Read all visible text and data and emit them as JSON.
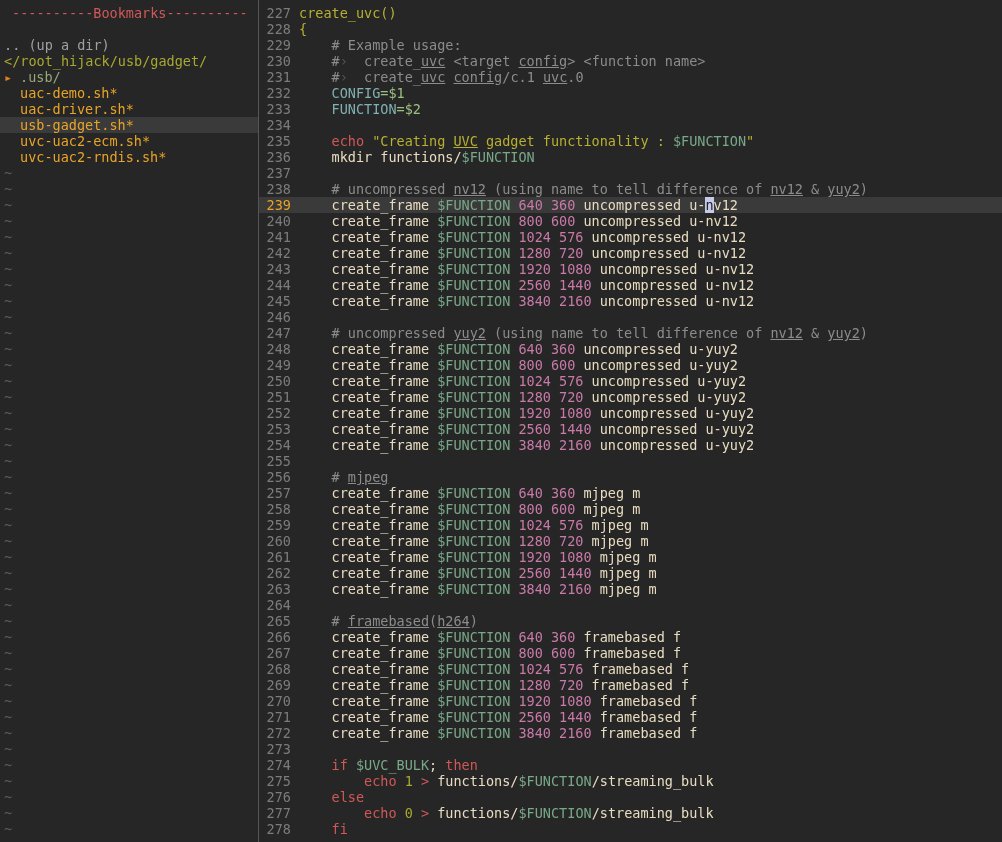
{
  "tree": {
    "items": [
      {
        "kind": "bookmarks",
        "text": "----------Bookmarks----------",
        "selected": false
      },
      {
        "kind": "blank",
        "selected": false
      },
      {
        "kind": "updir",
        "text": ".. (up a dir)",
        "selected": false
      },
      {
        "kind": "root",
        "text": "</root_hijack/usb/gadget/",
        "selected": false
      },
      {
        "kind": "dir",
        "arrow": "▸",
        "text": ".usb/",
        "selected": false
      },
      {
        "kind": "file",
        "text": "uac-demo.sh*",
        "selected": false
      },
      {
        "kind": "file",
        "text": "uac-driver.sh*",
        "selected": false
      },
      {
        "kind": "file",
        "text": "usb-gadget.sh*",
        "selected": true
      },
      {
        "kind": "file",
        "text": "uvc-uac2-ecm.sh*",
        "selected": false
      },
      {
        "kind": "file",
        "text": "uvc-uac2-rndis.sh*",
        "selected": false
      }
    ],
    "filler": [
      "~",
      "~",
      "~",
      "~",
      "~",
      "~",
      "~",
      "~",
      "~",
      "~",
      "~",
      "~",
      "~",
      "~",
      "~",
      "~",
      "~",
      "~",
      "~",
      "~",
      "~",
      "~",
      "~",
      "~",
      "~",
      "~",
      "~",
      "~",
      "~",
      "~",
      "~",
      "~",
      "~",
      "~",
      "~",
      "~",
      "~",
      "~",
      "~",
      "~",
      "~",
      "~"
    ]
  },
  "editor": {
    "lines": [
      {
        "number": "227",
        "current": false,
        "segments": [
          {
            "kind": "func",
            "text": "create_uvc()"
          }
        ]
      },
      {
        "number": "228",
        "current": false,
        "segments": [
          {
            "kind": "func",
            "text": "{"
          }
        ]
      },
      {
        "number": "229",
        "current": false,
        "segments": [
          {
            "kind": "comment",
            "text": "    # Example usage:"
          }
        ]
      },
      {
        "number": "230",
        "current": false,
        "segments": [
          {
            "kind": "comment",
            "text": "    #"
          },
          {
            "kind": "tab",
            "text": "›"
          },
          {
            "kind": "comment",
            "text": "  create_"
          },
          {
            "kind": "spell",
            "text": "uvc"
          },
          {
            "kind": "comment",
            "text": " <target "
          },
          {
            "kind": "spell",
            "text": "config"
          },
          {
            "kind": "comment",
            "text": "> <function name>"
          }
        ]
      },
      {
        "number": "231",
        "current": false,
        "segments": [
          {
            "kind": "comment",
            "text": "    #"
          },
          {
            "kind": "tab",
            "text": "›"
          },
          {
            "kind": "comment",
            "text": "  create_"
          },
          {
            "kind": "spell",
            "text": "uvc"
          },
          {
            "kind": "spacedspell",
            "text": " config"
          },
          {
            "kind": "comment",
            "text": "/c.1 "
          },
          {
            "kind": "spell",
            "text": "uvc"
          },
          {
            "kind": "comment",
            "text": ".0"
          }
        ]
      },
      {
        "number": "232",
        "current": false,
        "segments": [
          {
            "kind": "var",
            "text": "    CONFIG"
          },
          {
            "kind": "op",
            "text": "=$1"
          }
        ]
      },
      {
        "number": "233",
        "current": false,
        "segments": [
          {
            "kind": "var",
            "text": "    FUNCTION"
          },
          {
            "kind": "op",
            "text": "=$2"
          }
        ]
      },
      {
        "number": "234",
        "current": false
      },
      {
        "number": "235",
        "current": false,
        "segments": [
          {
            "kind": "kw",
            "text": "    echo"
          },
          {
            "kind": "str",
            "text": " \"Creating "
          },
          {
            "kind": "strspell",
            "text": "UVC"
          },
          {
            "kind": "str",
            "text": " gadget functionality : "
          },
          {
            "kind": "env",
            "text": "$FUNCTION"
          },
          {
            "kind": "str",
            "text": "\""
          }
        ]
      },
      {
        "number": "236",
        "current": false,
        "segments": [
          {
            "kind": "plain",
            "text": "    mkdir functions/"
          },
          {
            "kind": "env",
            "text": "$FUNCTION"
          }
        ]
      },
      {
        "number": "237",
        "current": false
      },
      {
        "number": "238",
        "current": false,
        "segments": [
          {
            "kind": "comment",
            "text": "    # uncompressed "
          },
          {
            "kind": "spell",
            "text": "nv12"
          },
          {
            "kind": "comment",
            "text": " (using name to tell difference of "
          },
          {
            "kind": "spell",
            "text": "nv12"
          },
          {
            "kind": "comment",
            "text": " & "
          },
          {
            "kind": "spell",
            "text": "yuy2"
          },
          {
            "kind": "comment",
            "text": ")"
          }
        ]
      },
      {
        "number": "239",
        "current": true,
        "segments": [
          {
            "kind": "plain",
            "text": "    create_frame "
          },
          {
            "kind": "env",
            "text": "$FUNCTION"
          },
          {
            "kind": "num",
            "text": " 640 360"
          },
          {
            "kind": "plain",
            "text": " uncompressed u-"
          },
          {
            "kind": "cursor",
            "text": "n"
          },
          {
            "kind": "plain",
            "text": "v12"
          }
        ]
      },
      {
        "number": "240",
        "current": false,
        "segments": [
          {
            "kind": "plain",
            "text": "    create_frame "
          },
          {
            "kind": "env",
            "text": "$FUNCTION"
          },
          {
            "kind": "num",
            "text": " 800 600"
          },
          {
            "kind": "plain",
            "text": " uncompressed u-nv12"
          }
        ]
      },
      {
        "number": "241",
        "current": false,
        "segments": [
          {
            "kind": "plain",
            "text": "    create_frame "
          },
          {
            "kind": "env",
            "text": "$FUNCTION"
          },
          {
            "kind": "num",
            "text": " 1024 576"
          },
          {
            "kind": "plain",
            "text": " uncompressed u-nv12"
          }
        ]
      },
      {
        "number": "242",
        "current": false,
        "segments": [
          {
            "kind": "plain",
            "text": "    create_frame "
          },
          {
            "kind": "env",
            "text": "$FUNCTION"
          },
          {
            "kind": "num",
            "text": " 1280 720"
          },
          {
            "kind": "plain",
            "text": " uncompressed u-nv12"
          }
        ]
      },
      {
        "number": "243",
        "current": false,
        "segments": [
          {
            "kind": "plain",
            "text": "    create_frame "
          },
          {
            "kind": "env",
            "text": "$FUNCTION"
          },
          {
            "kind": "num",
            "text": " 1920 1080"
          },
          {
            "kind": "plain",
            "text": " uncompressed u-nv12"
          }
        ]
      },
      {
        "number": "244",
        "current": false,
        "segments": [
          {
            "kind": "plain",
            "text": "    create_frame "
          },
          {
            "kind": "env",
            "text": "$FUNCTION"
          },
          {
            "kind": "num",
            "text": " 2560 1440"
          },
          {
            "kind": "plain",
            "text": " uncompressed u-nv12"
          }
        ]
      },
      {
        "number": "245",
        "current": false,
        "segments": [
          {
            "kind": "plain",
            "text": "    create_frame "
          },
          {
            "kind": "env",
            "text": "$FUNCTION"
          },
          {
            "kind": "num",
            "text": " 3840 2160"
          },
          {
            "kind": "plain",
            "text": " uncompressed u-nv12"
          }
        ]
      },
      {
        "number": "246",
        "current": false
      },
      {
        "number": "247",
        "current": false,
        "segments": [
          {
            "kind": "comment",
            "text": "    # uncompressed "
          },
          {
            "kind": "spell",
            "text": "yuy2"
          },
          {
            "kind": "comment",
            "text": " (using name to tell difference of "
          },
          {
            "kind": "spell",
            "text": "nv12"
          },
          {
            "kind": "comment",
            "text": " & "
          },
          {
            "kind": "spell",
            "text": "yuy2"
          },
          {
            "kind": "comment",
            "text": ")"
          }
        ]
      },
      {
        "number": "248",
        "current": false,
        "segments": [
          {
            "kind": "plain",
            "text": "    create_frame "
          },
          {
            "kind": "env",
            "text": "$FUNCTION"
          },
          {
            "kind": "num",
            "text": " 640 360"
          },
          {
            "kind": "plain",
            "text": " uncompressed u-yuy2"
          }
        ]
      },
      {
        "number": "249",
        "current": false,
        "segments": [
          {
            "kind": "plain",
            "text": "    create_frame "
          },
          {
            "kind": "env",
            "text": "$FUNCTION"
          },
          {
            "kind": "num",
            "text": " 800 600"
          },
          {
            "kind": "plain",
            "text": " uncompressed u-yuy2"
          }
        ]
      },
      {
        "number": "250",
        "current": false,
        "segments": [
          {
            "kind": "plain",
            "text": "    create_frame "
          },
          {
            "kind": "env",
            "text": "$FUNCTION"
          },
          {
            "kind": "num",
            "text": " 1024 576"
          },
          {
            "kind": "plain",
            "text": " uncompressed u-yuy2"
          }
        ]
      },
      {
        "number": "251",
        "current": false,
        "segments": [
          {
            "kind": "plain",
            "text": "    create_frame "
          },
          {
            "kind": "env",
            "text": "$FUNCTION"
          },
          {
            "kind": "num",
            "text": " 1280 720"
          },
          {
            "kind": "plain",
            "text": " uncompressed u-yuy2"
          }
        ]
      },
      {
        "number": "252",
        "current": false,
        "segments": [
          {
            "kind": "plain",
            "text": "    create_frame "
          },
          {
            "kind": "env",
            "text": "$FUNCTION"
          },
          {
            "kind": "num",
            "text": " 1920 1080"
          },
          {
            "kind": "plain",
            "text": " uncompressed u-yuy2"
          }
        ]
      },
      {
        "number": "253",
        "current": false,
        "segments": [
          {
            "kind": "plain",
            "text": "    create_frame "
          },
          {
            "kind": "env",
            "text": "$FUNCTION"
          },
          {
            "kind": "num",
            "text": " 2560 1440"
          },
          {
            "kind": "plain",
            "text": " uncompressed u-yuy2"
          }
        ]
      },
      {
        "number": "254",
        "current": false,
        "segments": [
          {
            "kind": "plain",
            "text": "    create_frame "
          },
          {
            "kind": "env",
            "text": "$FUNCTION"
          },
          {
            "kind": "num",
            "text": " 3840 2160"
          },
          {
            "kind": "plain",
            "text": " uncompressed u-yuy2"
          }
        ]
      },
      {
        "number": "255",
        "current": false
      },
      {
        "number": "256",
        "current": false,
        "segments": [
          {
            "kind": "comment",
            "text": "    # "
          },
          {
            "kind": "spell",
            "text": "mjpeg"
          }
        ]
      },
      {
        "number": "257",
        "current": false,
        "segments": [
          {
            "kind": "plain",
            "text": "    create_frame "
          },
          {
            "kind": "env",
            "text": "$FUNCTION"
          },
          {
            "kind": "num",
            "text": " 640 360"
          },
          {
            "kind": "plain",
            "text": " mjpeg m"
          }
        ]
      },
      {
        "number": "258",
        "current": false,
        "segments": [
          {
            "kind": "plain",
            "text": "    create_frame "
          },
          {
            "kind": "env",
            "text": "$FUNCTION"
          },
          {
            "kind": "num",
            "text": " 800 600"
          },
          {
            "kind": "plain",
            "text": " mjpeg m"
          }
        ]
      },
      {
        "number": "259",
        "current": false,
        "segments": [
          {
            "kind": "plain",
            "text": "    create_frame "
          },
          {
            "kind": "env",
            "text": "$FUNCTION"
          },
          {
            "kind": "num",
            "text": " 1024 576"
          },
          {
            "kind": "plain",
            "text": " mjpeg m"
          }
        ]
      },
      {
        "number": "260",
        "current": false,
        "segments": [
          {
            "kind": "plain",
            "text": "    create_frame "
          },
          {
            "kind": "env",
            "text": "$FUNCTION"
          },
          {
            "kind": "num",
            "text": " 1280 720"
          },
          {
            "kind": "plain",
            "text": " mjpeg m"
          }
        ]
      },
      {
        "number": "261",
        "current": false,
        "segments": [
          {
            "kind": "plain",
            "text": "    create_frame "
          },
          {
            "kind": "env",
            "text": "$FUNCTION"
          },
          {
            "kind": "num",
            "text": " 1920 1080"
          },
          {
            "kind": "plain",
            "text": " mjpeg m"
          }
        ]
      },
      {
        "number": "262",
        "current": false,
        "segments": [
          {
            "kind": "plain",
            "text": "    create_frame "
          },
          {
            "kind": "env",
            "text": "$FUNCTION"
          },
          {
            "kind": "num",
            "text": " 2560 1440"
          },
          {
            "kind": "plain",
            "text": " mjpeg m"
          }
        ]
      },
      {
        "number": "263",
        "current": false,
        "segments": [
          {
            "kind": "plain",
            "text": "    create_frame "
          },
          {
            "kind": "env",
            "text": "$FUNCTION"
          },
          {
            "kind": "num",
            "text": " 3840 2160"
          },
          {
            "kind": "plain",
            "text": " mjpeg m"
          }
        ]
      },
      {
        "number": "264",
        "current": false
      },
      {
        "number": "265",
        "current": false,
        "segments": [
          {
            "kind": "comment",
            "text": "    # "
          },
          {
            "kind": "spell",
            "text": "framebased"
          },
          {
            "kind": "comment",
            "text": "("
          },
          {
            "kind": "spell",
            "text": "h264"
          },
          {
            "kind": "comment",
            "text": ")"
          }
        ]
      },
      {
        "number": "266",
        "current": false,
        "segments": [
          {
            "kind": "plain",
            "text": "    create_frame "
          },
          {
            "kind": "env",
            "text": "$FUNCTION"
          },
          {
            "kind": "num",
            "text": " 640 360"
          },
          {
            "kind": "plain",
            "text": " framebased f"
          }
        ]
      },
      {
        "number": "267",
        "current": false,
        "segments": [
          {
            "kind": "plain",
            "text": "    create_frame "
          },
          {
            "kind": "env",
            "text": "$FUNCTION"
          },
          {
            "kind": "num",
            "text": " 800 600"
          },
          {
            "kind": "plain",
            "text": " framebased f"
          }
        ]
      },
      {
        "number": "268",
        "current": false,
        "segments": [
          {
            "kind": "plain",
            "text": "    create_frame "
          },
          {
            "kind": "env",
            "text": "$FUNCTION"
          },
          {
            "kind": "num",
            "text": " 1024 576"
          },
          {
            "kind": "plain",
            "text": " framebased f"
          }
        ]
      },
      {
        "number": "269",
        "current": false,
        "segments": [
          {
            "kind": "plain",
            "text": "    create_frame "
          },
          {
            "kind": "env",
            "text": "$FUNCTION"
          },
          {
            "kind": "num",
            "text": " 1280 720"
          },
          {
            "kind": "plain",
            "text": " framebased f"
          }
        ]
      },
      {
        "number": "270",
        "current": false,
        "segments": [
          {
            "kind": "plain",
            "text": "    create_frame "
          },
          {
            "kind": "env",
            "text": "$FUNCTION"
          },
          {
            "kind": "num",
            "text": " 1920 1080"
          },
          {
            "kind": "plain",
            "text": " framebased f"
          }
        ]
      },
      {
        "number": "271",
        "current": false,
        "segments": [
          {
            "kind": "plain",
            "text": "    create_frame "
          },
          {
            "kind": "env",
            "text": "$FUNCTION"
          },
          {
            "kind": "num",
            "text": " 2560 1440"
          },
          {
            "kind": "plain",
            "text": " framebased f"
          }
        ]
      },
      {
        "number": "272",
        "current": false,
        "segments": [
          {
            "kind": "plain",
            "text": "    create_frame "
          },
          {
            "kind": "env",
            "text": "$FUNCTION"
          },
          {
            "kind": "num",
            "text": " 3840 2160"
          },
          {
            "kind": "plain",
            "text": " framebased f"
          }
        ]
      },
      {
        "number": "273",
        "current": false
      },
      {
        "number": "274",
        "current": false,
        "segments": [
          {
            "kind": "kw",
            "text": "    if"
          },
          {
            "kind": "env",
            "text": " $UVC_BULK"
          },
          {
            "kind": "plain",
            "text": "; "
          },
          {
            "kind": "kw",
            "text": "then"
          }
        ]
      },
      {
        "number": "275",
        "current": false,
        "segments": [
          {
            "kind": "kw",
            "text": "        echo"
          },
          {
            "kind": "digit",
            "text": " 1"
          },
          {
            "kind": "kw",
            "text": " >"
          },
          {
            "kind": "plain",
            "text": " functions/"
          },
          {
            "kind": "env",
            "text": "$FUNCTION"
          },
          {
            "kind": "plain",
            "text": "/streaming_bulk"
          }
        ]
      },
      {
        "number": "276",
        "current": false,
        "segments": [
          {
            "kind": "kw",
            "text": "    else"
          }
        ]
      },
      {
        "number": "277",
        "current": false,
        "segments": [
          {
            "kind": "kw",
            "text": "        echo"
          },
          {
            "kind": "digit",
            "text": " 0"
          },
          {
            "kind": "kw",
            "text": " >"
          },
          {
            "kind": "plain",
            "text": " functions/"
          },
          {
            "kind": "env",
            "text": "$FUNCTION"
          },
          {
            "kind": "plain",
            "text": "/streaming_bulk"
          }
        ]
      },
      {
        "number": "278",
        "current": false,
        "segments": [
          {
            "kind": "kw",
            "text": "    fi"
          }
        ]
      }
    ]
  }
}
